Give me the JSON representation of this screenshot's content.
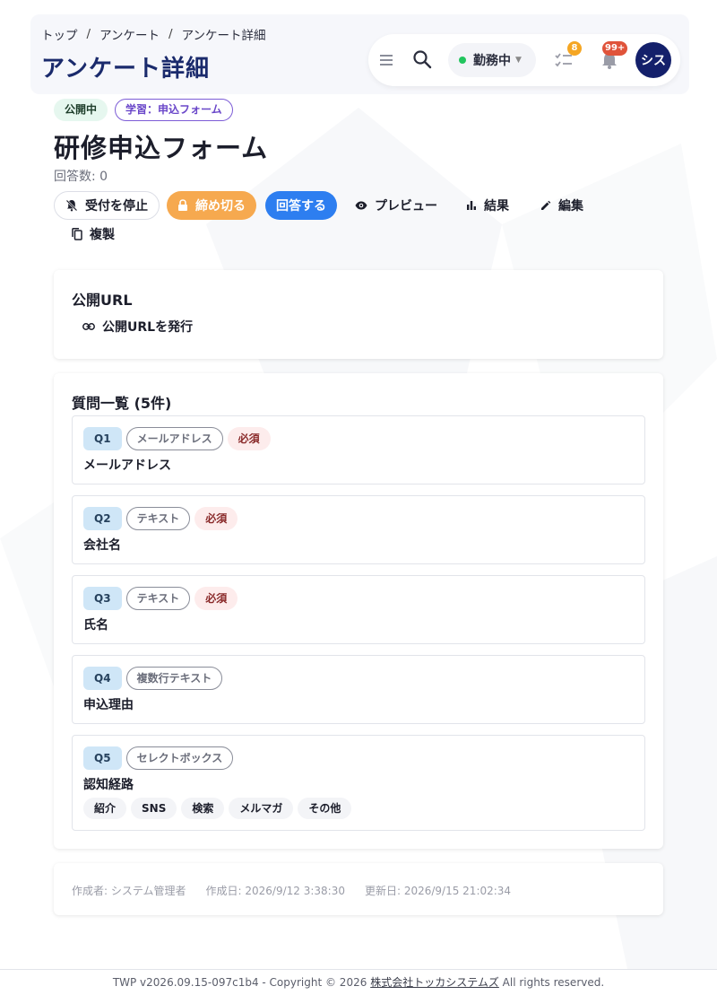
{
  "header": {
    "breadcrumb": [
      "トップ",
      "アンケート",
      "アンケート詳細"
    ],
    "title": "アンケート詳細"
  },
  "toolbar": {
    "status_label": "勤務中",
    "status_color": "#22c55e",
    "tasks_badge": "8",
    "notifications_badge": "99+",
    "avatar_text": "シス"
  },
  "survey": {
    "status_chip": "公開中",
    "category_chip": "学習：申込フォーム",
    "title": "研修申込フォーム",
    "answer_count": "回答数: 0"
  },
  "actions": {
    "stop": "受付を停止",
    "close": "締め切る",
    "answer": "回答する",
    "preview": "プレビュー",
    "results": "結果",
    "edit": "編集",
    "duplicate": "複製"
  },
  "public_url": {
    "title": "公開URL",
    "issue_button": "公開URLを発行"
  },
  "questions": {
    "title": "質問一覧 (5件)",
    "items": [
      {
        "num": "Q1",
        "type": "メールアドレス",
        "required": "必須",
        "label": "メールアドレス"
      },
      {
        "num": "Q2",
        "type": "テキスト",
        "required": "必須",
        "label": "会社名"
      },
      {
        "num": "Q3",
        "type": "テキスト",
        "required": "必須",
        "label": "氏名"
      },
      {
        "num": "Q4",
        "type": "複数行テキスト",
        "label": "申込理由"
      },
      {
        "num": "Q5",
        "type": "セレクトボックス",
        "label": "認知経路",
        "options": [
          "紹介",
          "SNS",
          "検索",
          "メルマガ",
          "その他"
        ]
      }
    ]
  },
  "meta": {
    "author": "作成者: システム管理者",
    "created": "作成日: 2026/9/12 3:38:30",
    "updated": "更新日: 2026/9/15 21:02:34"
  },
  "footer": {
    "prefix": "TWP v2026.09.15-097c1b4 - Copyright © 2026",
    "company": "株式会社トッカシステムズ",
    "suffix": "All rights reserved."
  },
  "colors": {
    "primary": "#2d7ef0",
    "orange": "#f6a94f",
    "title_navy": "#1a2a6c",
    "avatar": "#14206b"
  }
}
